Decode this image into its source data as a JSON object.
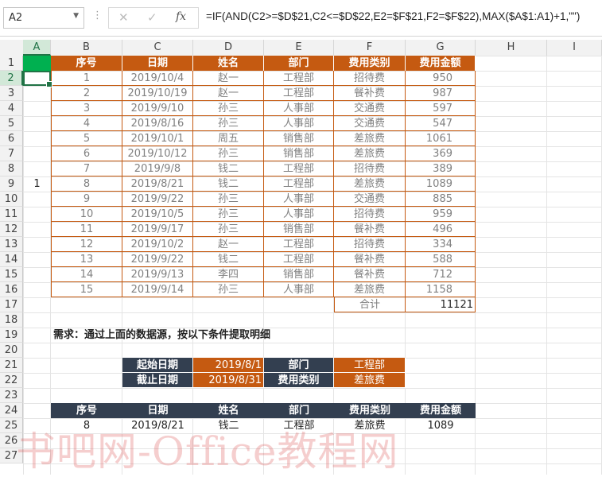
{
  "formula_bar": {
    "name_box": "A2",
    "dots": "⋮",
    "cancel": "✕",
    "enter": "✓",
    "fx": "fx",
    "formula": "=IF(AND(C2>=$D$21,C2<=$D$22,E2=$F$21,F2=$F$22),MAX($A$1:A1)+1,\"\")"
  },
  "columns": [
    "A",
    "B",
    "C",
    "D",
    "E",
    "F",
    "G",
    "H",
    "I"
  ],
  "rows": [
    "1",
    "2",
    "3",
    "4",
    "5",
    "6",
    "7",
    "8",
    "9",
    "10",
    "11",
    "12",
    "13",
    "14",
    "15",
    "16",
    "17",
    "18",
    "19",
    "20",
    "21",
    "22",
    "23",
    "24",
    "25",
    "26",
    "27"
  ],
  "table": {
    "headers": [
      "序号",
      "日期",
      "姓名",
      "部门",
      "费用类别",
      "费用金额"
    ],
    "rows": [
      [
        "1",
        "2019/10/4",
        "赵一",
        "工程部",
        "招待费",
        "950"
      ],
      [
        "2",
        "2019/10/19",
        "赵一",
        "工程部",
        "餐补费",
        "987"
      ],
      [
        "3",
        "2019/9/10",
        "孙三",
        "人事部",
        "交通费",
        "597"
      ],
      [
        "4",
        "2019/8/16",
        "孙三",
        "人事部",
        "交通费",
        "547"
      ],
      [
        "5",
        "2019/10/1",
        "周五",
        "销售部",
        "差旅费",
        "1061"
      ],
      [
        "6",
        "2019/10/12",
        "孙三",
        "销售部",
        "差旅费",
        "369"
      ],
      [
        "7",
        "2019/9/8",
        "钱二",
        "工程部",
        "招待费",
        "389"
      ],
      [
        "8",
        "2019/8/21",
        "钱二",
        "工程部",
        "差旅费",
        "1089"
      ],
      [
        "9",
        "2019/9/22",
        "孙三",
        "人事部",
        "交通费",
        "885"
      ],
      [
        "10",
        "2019/10/5",
        "孙三",
        "人事部",
        "招待费",
        "959"
      ],
      [
        "11",
        "2019/9/17",
        "孙三",
        "销售部",
        "餐补费",
        "496"
      ],
      [
        "12",
        "2019/10/2",
        "赵一",
        "工程部",
        "招待费",
        "334"
      ],
      [
        "13",
        "2019/9/22",
        "钱二",
        "工程部",
        "餐补费",
        "588"
      ],
      [
        "14",
        "2019/9/13",
        "李四",
        "销售部",
        "餐补费",
        "712"
      ],
      [
        "15",
        "2019/9/14",
        "孙三",
        "人事部",
        "差旅费",
        "1158"
      ]
    ],
    "total_label": "合计",
    "total_value": "11121"
  },
  "helper_col_a9": "1",
  "requirement": "需求：通过上面的数据源，按以下条件提取明细",
  "criteria": {
    "start_label": "起始日期",
    "start_value": "2019/8/1",
    "end_label": "截止日期",
    "end_value": "2019/8/31",
    "dept_label": "部门",
    "dept_value": "工程部",
    "cat_label": "费用类别",
    "cat_value": "差旅费"
  },
  "result": {
    "headers": [
      "序号",
      "日期",
      "姓名",
      "部门",
      "费用类别",
      "费用金额"
    ],
    "row": [
      "8",
      "2019/8/21",
      "钱二",
      "工程部",
      "差旅费",
      "1089"
    ]
  },
  "watermark": "书吧网-Office教程网",
  "colors": {
    "orange": "#c55a11",
    "dark": "#333f50",
    "excel_green": "#217346",
    "a1_fill": "#00b050"
  }
}
